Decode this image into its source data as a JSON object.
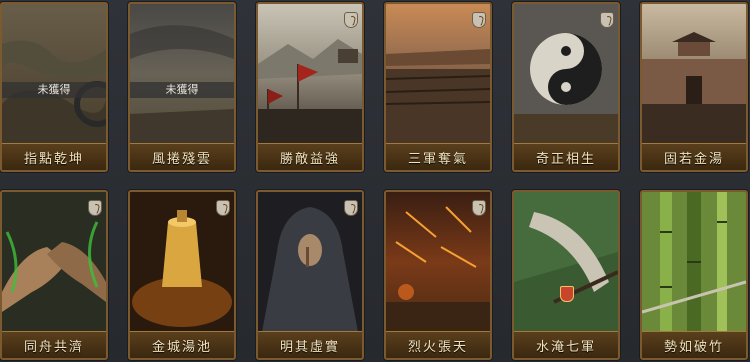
{
  "cards": [
    {
      "name": "指點乾坤",
      "status": "未獲得"
    },
    {
      "name": "風捲殘雲",
      "status": "未獲得"
    },
    {
      "name": "勝敵益強"
    },
    {
      "name": "三軍奪氣"
    },
    {
      "name": "奇正相生"
    },
    {
      "name": "固若金湯"
    },
    {
      "name": "同舟共濟"
    },
    {
      "name": "金城湯池"
    },
    {
      "name": "明其虛實"
    },
    {
      "name": "烈火張天"
    },
    {
      "name": "水淹七軍"
    },
    {
      "name": "勢如破竹"
    }
  ]
}
